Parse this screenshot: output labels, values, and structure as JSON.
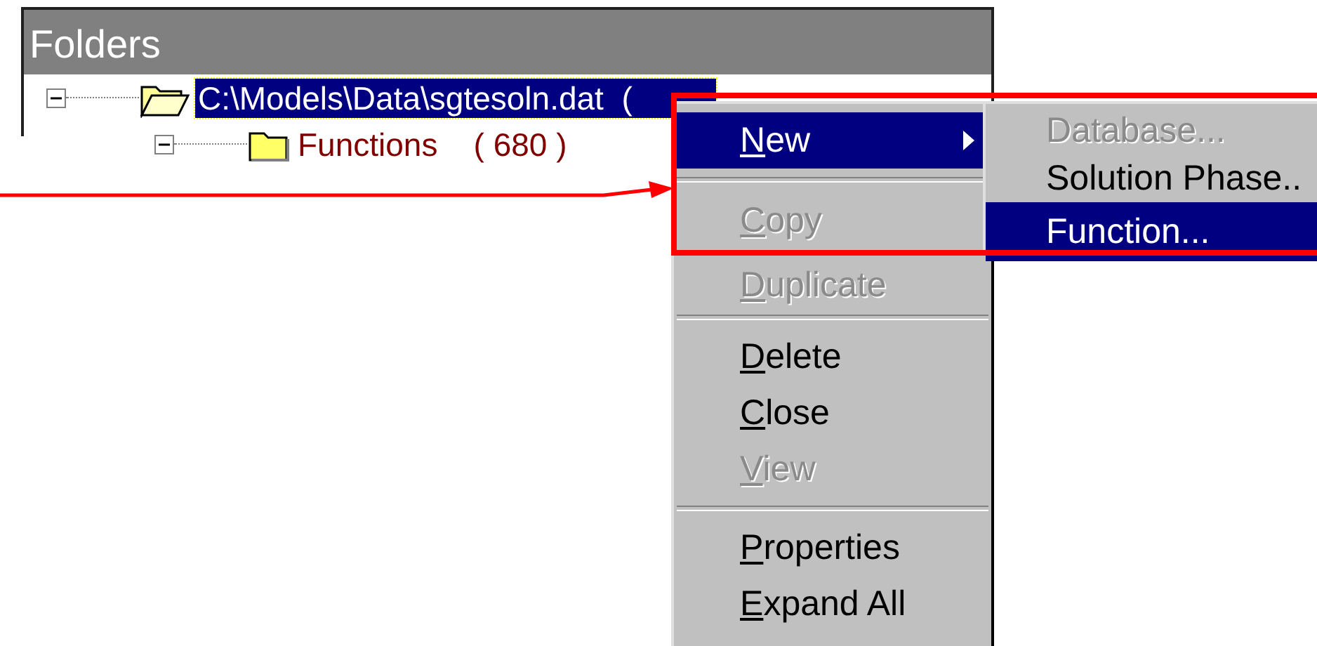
{
  "panel": {
    "title": "Folders"
  },
  "tree": [
    {
      "label": "C:\\Models\\Data\\sgtesoln.dat  (",
      "selected": true,
      "expanded": true,
      "children": [
        {
          "label": "Functions    ( 680 )",
          "selected": false,
          "expanded": true
        }
      ]
    }
  ],
  "context_menu": {
    "items": [
      {
        "kind": "item",
        "label": "New",
        "selected": true,
        "disabled": false,
        "submenu": true
      },
      {
        "kind": "separator"
      },
      {
        "kind": "item",
        "label": "Copy",
        "selected": false,
        "disabled": true,
        "submenu": false
      },
      {
        "kind": "item",
        "label": "Duplicate",
        "selected": false,
        "disabled": true,
        "submenu": false
      },
      {
        "kind": "separator"
      },
      {
        "kind": "item",
        "label": "Delete",
        "selected": false,
        "disabled": false,
        "submenu": false
      },
      {
        "kind": "item",
        "label": "Close",
        "selected": false,
        "disabled": false,
        "submenu": false
      },
      {
        "kind": "item",
        "label": "View",
        "selected": false,
        "disabled": true,
        "submenu": false
      },
      {
        "kind": "separator"
      },
      {
        "kind": "item",
        "label": "Properties",
        "selected": false,
        "disabled": false,
        "submenu": false
      },
      {
        "kind": "item",
        "label": "Expand All",
        "selected": false,
        "disabled": false,
        "submenu": false
      }
    ]
  },
  "submenu": {
    "items": [
      {
        "label": "Database...",
        "selected": false,
        "disabled": true
      },
      {
        "label": "Solution Phase..",
        "selected": false,
        "disabled": false
      },
      {
        "label": "Function...",
        "selected": true,
        "disabled": false
      }
    ]
  }
}
